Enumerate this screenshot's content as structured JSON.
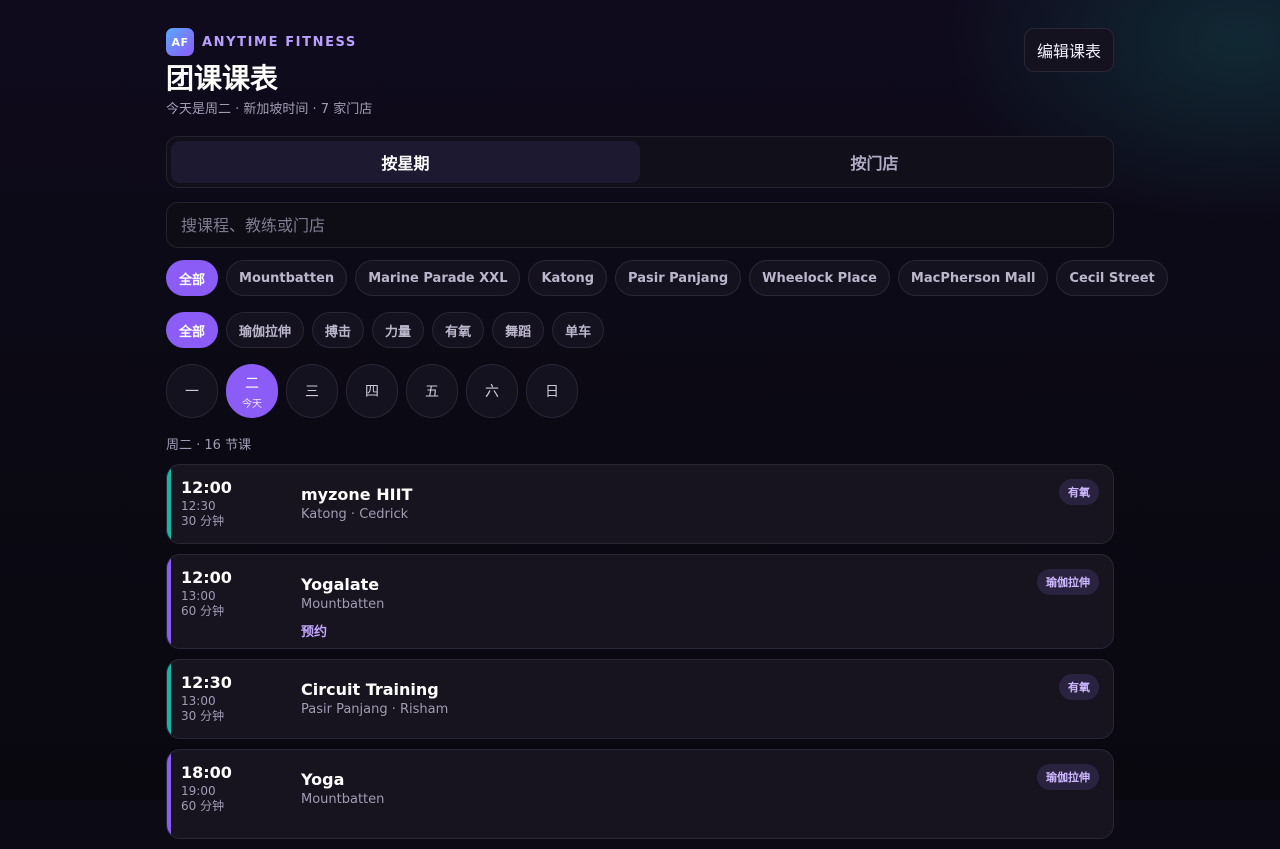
{
  "brand": {
    "logo": "AF",
    "name": "ANYTIME FITNESS"
  },
  "header": {
    "title": "团课课表",
    "subtitle": "今天是周二 · 新加坡时间 · 7 家门店",
    "edit_label": "编辑课表"
  },
  "view_tabs": [
    {
      "label": "按星期",
      "active": true
    },
    {
      "label": "按门店",
      "active": false
    }
  ],
  "search": {
    "placeholder": "搜课程、教练或门店",
    "value": ""
  },
  "store_filters": [
    {
      "label": "全部",
      "active": true
    },
    {
      "label": "Mountbatten",
      "active": false
    },
    {
      "label": "Marine Parade XXL",
      "active": false
    },
    {
      "label": "Katong",
      "active": false
    },
    {
      "label": "Pasir Panjang",
      "active": false
    },
    {
      "label": "Wheelock Place",
      "active": false
    },
    {
      "label": "MacPherson Mall",
      "active": false
    },
    {
      "label": "Cecil Street",
      "active": false
    }
  ],
  "type_filters": [
    {
      "label": "全部",
      "active": true
    },
    {
      "label": "瑜伽拉伸",
      "active": false
    },
    {
      "label": "搏击",
      "active": false
    },
    {
      "label": "力量",
      "active": false
    },
    {
      "label": "有氧",
      "active": false
    },
    {
      "label": "舞蹈",
      "active": false
    },
    {
      "label": "单车",
      "active": false
    }
  ],
  "days": [
    {
      "label": "一",
      "active": false,
      "note": ""
    },
    {
      "label": "二",
      "active": true,
      "note": "今天"
    },
    {
      "label": "三",
      "active": false,
      "note": ""
    },
    {
      "label": "四",
      "active": false,
      "note": ""
    },
    {
      "label": "五",
      "active": false,
      "note": ""
    },
    {
      "label": "六",
      "active": false,
      "note": ""
    },
    {
      "label": "日",
      "active": false,
      "note": ""
    }
  ],
  "count_line": "周二 · 16 节课",
  "colors": {
    "accent": "#8b5cf6",
    "cardio": "#14b8a6",
    "yoga": "#8b5cf6"
  },
  "classes": [
    {
      "start": "12:00",
      "end": "12:30",
      "duration": "30 分钟",
      "name": "myzone HIIT",
      "meta": "Katong · Cedrick",
      "tag": "有氧",
      "book": "",
      "accent": "#14b8a6"
    },
    {
      "start": "12:00",
      "end": "13:00",
      "duration": "60 分钟",
      "name": "Yogalate",
      "meta": "Mountbatten",
      "tag": "瑜伽拉伸",
      "book": "预约",
      "accent": "#8b5cf6"
    },
    {
      "start": "12:30",
      "end": "13:00",
      "duration": "30 分钟",
      "name": "Circuit Training",
      "meta": "Pasir Panjang · Risham",
      "tag": "有氧",
      "book": "",
      "accent": "#14b8a6"
    },
    {
      "start": "18:00",
      "end": "19:00",
      "duration": "60 分钟",
      "name": "Yoga",
      "meta": "Mountbatten",
      "tag": "瑜伽拉伸",
      "book": "",
      "accent": "#8b5cf6"
    }
  ]
}
